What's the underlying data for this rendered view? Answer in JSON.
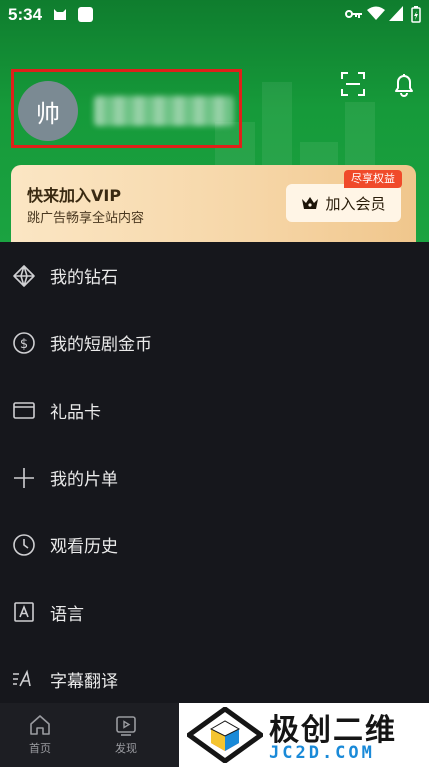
{
  "status": {
    "time": "5:34"
  },
  "profile": {
    "avatar_char": "帅",
    "username": ""
  },
  "vip": {
    "title": "快来加入VIP",
    "subtitle": "跳广告畅享全站内容",
    "tag": "尽享权益",
    "button": "加入会员"
  },
  "menu": [
    {
      "label": "我的钻石",
      "icon": "diamond-icon"
    },
    {
      "label": "我的短剧金币",
      "icon": "coin-icon"
    },
    {
      "label": "礼品卡",
      "icon": "card-icon"
    },
    {
      "label": "我的片单",
      "icon": "plus-icon"
    },
    {
      "label": "观看历史",
      "icon": "clock-icon"
    },
    {
      "label": "语言",
      "icon": "language-icon"
    },
    {
      "label": "字幕翻译",
      "icon": "subtitle-translate-icon"
    }
  ],
  "tabs": [
    {
      "label": "首页",
      "icon": "home-icon"
    },
    {
      "label": "发现",
      "icon": "discover-icon"
    }
  ],
  "watermark": {
    "title": "极创二维",
    "domain": "JC2D.COM"
  },
  "colors": {
    "header_green": "#169a3a",
    "highlight_red": "#e0201a",
    "vip_gold": "#f6d6a7",
    "menu_bg": "#16171c"
  }
}
